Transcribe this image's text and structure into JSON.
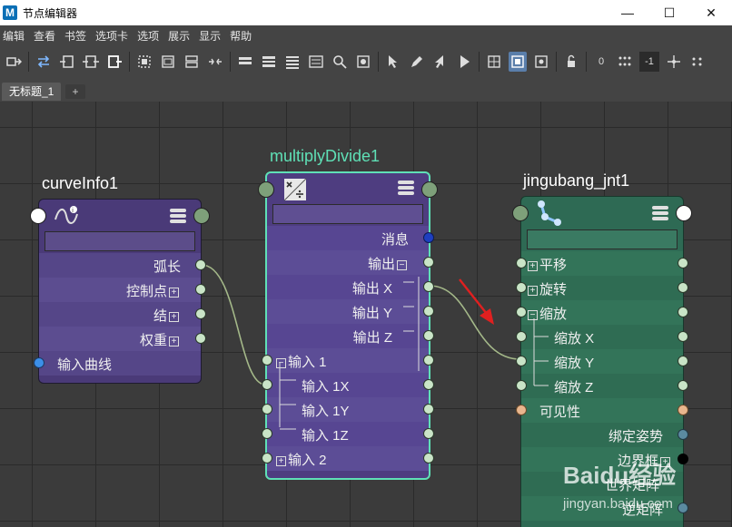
{
  "window": {
    "title": "节点编辑器",
    "app_icon": "M",
    "minimize": "—",
    "maximize": "☐",
    "close": "✕"
  },
  "menu": [
    "编辑",
    "查看",
    "书签",
    "选项卡",
    "选项",
    "展示",
    "显示",
    "帮助"
  ],
  "toolbar": {
    "field_zero": "0",
    "field_neg1": "-1"
  },
  "tabs": {
    "active": "无标题_1",
    "add": "+"
  },
  "nodes": {
    "curve_info": {
      "title": "curveInfo1",
      "rows": {
        "arc_length": "弧长",
        "control_points": "控制点",
        "knots": "结",
        "weights": "权重",
        "input_curve": "输入曲线"
      }
    },
    "multiply_divide": {
      "title": "multiplyDivide1",
      "rows": {
        "message": "消息",
        "output": "输出",
        "output_x": "输出 X",
        "output_y": "输出 Y",
        "output_z": "输出 Z",
        "input1": "输入 1",
        "input1x": "输入 1X",
        "input1y": "输入 1Y",
        "input1z": "输入 1Z",
        "input2": "输入 2"
      }
    },
    "joint": {
      "title": "jingubang_jnt1",
      "rows": {
        "translate": "平移",
        "rotate": "旋转",
        "scale": "缩放",
        "scale_x": "缩放 X",
        "scale_y": "缩放 Y",
        "scale_z": "缩放 Z",
        "visibility": "可见性",
        "bind_pose": "绑定姿势",
        "bounding_box": "边界框",
        "world_matrix": "逆矩阵",
        "extra": "世界矩阵"
      }
    }
  },
  "expand_plus": "+",
  "expand_minus": "−",
  "watermark": {
    "line1": "Baidu经验",
    "line2": "jingyan.baidu.com"
  },
  "colors": {
    "curve_node": "#4a3a78",
    "mult_node": "#4e3d80",
    "joint_node": "#2e6a54",
    "mult_border": "#5fe0b6",
    "annotation_arrow": "#e02020"
  }
}
